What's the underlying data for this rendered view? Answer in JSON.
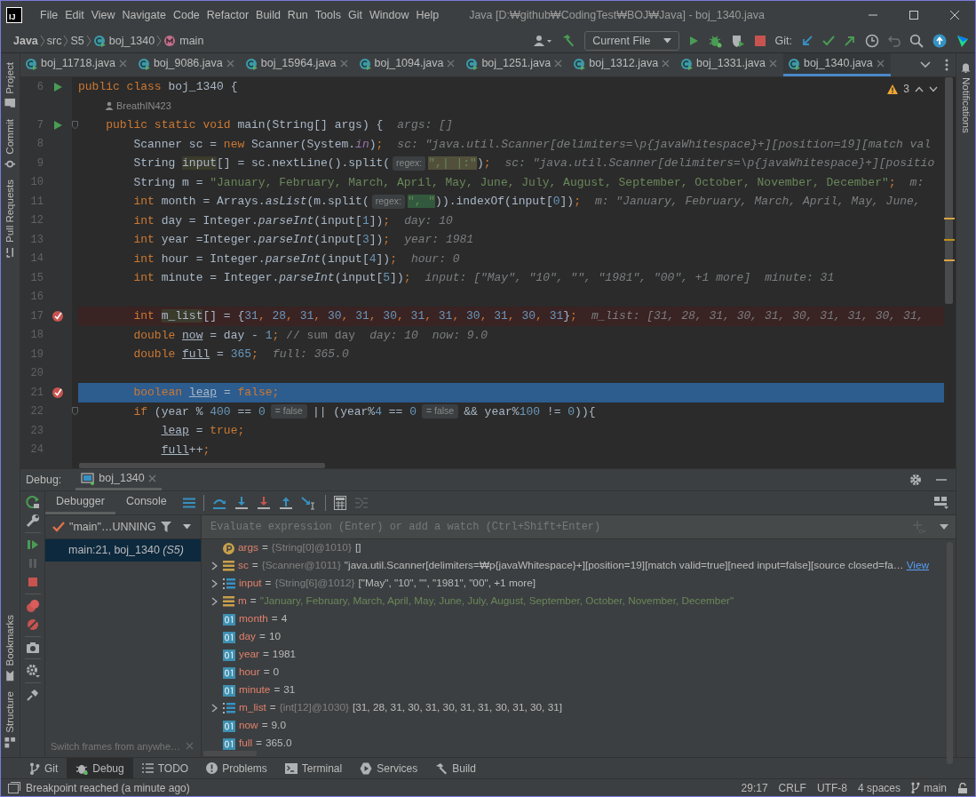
{
  "window": {
    "logo": "IJ",
    "title": "Java [D:₩github₩CodingTest₩BOJ₩Java] - boj_1340.java"
  },
  "menu": [
    "File",
    "Edit",
    "View",
    "Navigate",
    "Code",
    "Refactor",
    "Build",
    "Run",
    "Tools",
    "Git",
    "Window",
    "Help"
  ],
  "breadcrumbs": [
    {
      "kind": "root",
      "label": "Java"
    },
    {
      "kind": "plain",
      "label": "src"
    },
    {
      "kind": "plain",
      "label": "S5"
    },
    {
      "kind": "class",
      "label": "boj_1340"
    },
    {
      "kind": "method",
      "label": "main"
    }
  ],
  "toolbar": {
    "run_config": "Current File",
    "git_label": "Git:"
  },
  "left_tools": [
    {
      "kind": "project",
      "label": "Project"
    },
    {
      "kind": "commit",
      "label": "Commit"
    },
    {
      "kind": "pull",
      "label": "Pull Requests"
    }
  ],
  "left_tools_bottom": [
    {
      "kind": "bookmarks",
      "label": "Bookmarks"
    },
    {
      "kind": "structure",
      "label": "Structure"
    }
  ],
  "right_tools": [
    {
      "label": "Notifications"
    }
  ],
  "tabs": [
    {
      "label": "boj_11718.java",
      "selected": false
    },
    {
      "label": "boj_9086.java",
      "selected": false
    },
    {
      "label": "boj_15964.java",
      "selected": false
    },
    {
      "label": "boj_1094.java",
      "selected": false
    },
    {
      "label": "boj_1251.java",
      "selected": false
    },
    {
      "label": "boj_1312.java",
      "selected": false
    },
    {
      "label": "boj_1331.java",
      "selected": false
    },
    {
      "label": "boj_1340.java",
      "selected": true
    }
  ],
  "editor": {
    "warnings": "3",
    "lines": [
      {
        "kind": "code",
        "number": "6",
        "run": true,
        "breakpoint": false,
        "current": false,
        "fold": false,
        "parts": [
          {
            "kind": "code",
            "tokens": [
              {
                "kind": "kw",
                "text": "public class "
              },
              {
                "text": "boj_1340 {"
              }
            ]
          }
        ]
      },
      {
        "kind": "author",
        "text": "BreathIN423"
      },
      {
        "kind": "code",
        "number": "7",
        "run": true,
        "breakpoint": false,
        "current": false,
        "fold": true,
        "parts": [
          {
            "kind": "code",
            "tokens": [
              {
                "kind": "kw",
                "text": "    public static void "
              },
              {
                "text": "main(String[] args) {"
              }
            ]
          },
          {
            "kind": "hint",
            "text": "args: []"
          }
        ]
      },
      {
        "kind": "code",
        "number": "8",
        "run": false,
        "breakpoint": false,
        "current": false,
        "fold": false,
        "parts": [
          {
            "kind": "code",
            "tokens": [
              {
                "text": "        Scanner sc = "
              },
              {
                "kind": "kw",
                "text": "new "
              },
              {
                "text": "Scanner(System."
              },
              {
                "kind": "field",
                "text": "in"
              },
              {
                "text": ")"
              },
              {
                "kind": "kw",
                "text": ";"
              }
            ]
          },
          {
            "kind": "hint",
            "text": "sc: \"java.util.Scanner[delimiters=\\p{javaWhitespace}+][position=19][match val"
          }
        ]
      },
      {
        "kind": "code",
        "number": "9",
        "run": false,
        "breakpoint": false,
        "current": false,
        "fold": false,
        "parts": [
          {
            "kind": "code",
            "tokens": [
              {
                "text": "        String "
              },
              {
                "kind": "varhl",
                "text": "input"
              },
              {
                "text": "[] = sc.nextLine().split("
              }
            ]
          },
          {
            "kind": "param",
            "text": "regex:"
          },
          {
            "kind": "code",
            "tokens": [
              {
                "kind": "strhl",
                "text": "\",| |:\""
              },
              {
                "text": ")"
              },
              {
                "kind": "kw",
                "text": ";"
              }
            ]
          },
          {
            "kind": "hint",
            "text": "sc: \"java.util.Scanner[delimiters=\\p{javaWhitespace}+][positio"
          }
        ]
      },
      {
        "kind": "code",
        "number": "10",
        "run": false,
        "breakpoint": false,
        "current": false,
        "fold": false,
        "parts": [
          {
            "kind": "code",
            "tokens": [
              {
                "text": "        String m = "
              },
              {
                "kind": "str",
                "text": "\"January, February, March, April, May, June, July, August, September, October, November, December\""
              },
              {
                "kind": "kw",
                "text": ";"
              }
            ]
          },
          {
            "kind": "hint",
            "text": "m:"
          }
        ]
      },
      {
        "kind": "code",
        "number": "11",
        "run": false,
        "breakpoint": false,
        "current": false,
        "fold": false,
        "parts": [
          {
            "kind": "code",
            "tokens": [
              {
                "kind": "kw",
                "text": "        int "
              },
              {
                "text": "month = Arrays."
              },
              {
                "kind": "static",
                "text": "asList"
              },
              {
                "text": "(m.split("
              }
            ]
          },
          {
            "kind": "param",
            "text": "regex:"
          },
          {
            "kind": "code",
            "tokens": [
              {
                "kind": "strmatch",
                "text": "\", \""
              },
              {
                "text": ")).indexOf(input["
              },
              {
                "kind": "num",
                "text": "0"
              },
              {
                "text": "])"
              },
              {
                "kind": "kw",
                "text": ";"
              }
            ]
          },
          {
            "kind": "hint",
            "text": "m: \"January, February, March, April, May, June,"
          }
        ]
      },
      {
        "kind": "code",
        "number": "12",
        "run": false,
        "breakpoint": false,
        "current": false,
        "fold": false,
        "parts": [
          {
            "kind": "code",
            "tokens": [
              {
                "kind": "kw",
                "text": "        int "
              },
              {
                "text": "day = Integer."
              },
              {
                "kind": "static",
                "text": "parseInt"
              },
              {
                "text": "(input["
              },
              {
                "kind": "num",
                "text": "1"
              },
              {
                "text": "])"
              },
              {
                "kind": "kw",
                "text": ";"
              }
            ]
          },
          {
            "kind": "hint",
            "text": "day: 10"
          }
        ]
      },
      {
        "kind": "code",
        "number": "13",
        "run": false,
        "breakpoint": false,
        "current": false,
        "fold": false,
        "parts": [
          {
            "kind": "code",
            "tokens": [
              {
                "kind": "kw",
                "text": "        int "
              },
              {
                "text": "year =Integer."
              },
              {
                "kind": "static",
                "text": "parseInt"
              },
              {
                "text": "(input["
              },
              {
                "kind": "num",
                "text": "3"
              },
              {
                "text": "])"
              },
              {
                "kind": "kw",
                "text": ";"
              }
            ]
          },
          {
            "kind": "hint",
            "text": "year: 1981"
          }
        ]
      },
      {
        "kind": "code",
        "number": "14",
        "run": false,
        "breakpoint": false,
        "current": false,
        "fold": false,
        "parts": [
          {
            "kind": "code",
            "tokens": [
              {
                "kind": "kw",
                "text": "        int "
              },
              {
                "text": "hour = Integer."
              },
              {
                "kind": "static",
                "text": "parseInt"
              },
              {
                "text": "(input["
              },
              {
                "kind": "num",
                "text": "4"
              },
              {
                "text": "])"
              },
              {
                "kind": "kw",
                "text": ";"
              }
            ]
          },
          {
            "kind": "hint",
            "text": "hour: 0"
          }
        ]
      },
      {
        "kind": "code",
        "number": "15",
        "run": false,
        "breakpoint": false,
        "current": false,
        "fold": false,
        "parts": [
          {
            "kind": "code",
            "tokens": [
              {
                "kind": "kw",
                "text": "        int "
              },
              {
                "text": "minute = Integer."
              },
              {
                "kind": "static",
                "text": "parseInt"
              },
              {
                "text": "(input["
              },
              {
                "kind": "num",
                "text": "5"
              },
              {
                "text": "])"
              },
              {
                "kind": "kw",
                "text": ";"
              }
            ]
          },
          {
            "kind": "hint",
            "text": "input: [\"May\", \"10\", \"\", \"1981\", \"00\", +1 more]"
          },
          {
            "kind": "hint",
            "text": "minute: 31"
          }
        ]
      },
      {
        "kind": "code",
        "number": "16",
        "run": false,
        "breakpoint": false,
        "current": false,
        "fold": false
      },
      {
        "kind": "code",
        "number": "17",
        "run": false,
        "breakpoint": true,
        "current": false,
        "fold": false,
        "parts": [
          {
            "kind": "code",
            "tokens": [
              {
                "kind": "kw",
                "text": "        int "
              },
              {
                "kind": "varhl",
                "text": "m_list"
              },
              {
                "text": "[] = {"
              },
              {
                "kind": "num",
                "text": "31"
              },
              {
                "kind": "kw",
                "text": ", "
              },
              {
                "kind": "num",
                "text": "28"
              },
              {
                "kind": "kw",
                "text": ", "
              },
              {
                "kind": "num",
                "text": "31"
              },
              {
                "kind": "kw",
                "text": ", "
              },
              {
                "kind": "num",
                "text": "30"
              },
              {
                "kind": "kw",
                "text": ", "
              },
              {
                "kind": "num",
                "text": "31"
              },
              {
                "kind": "kw",
                "text": ", "
              },
              {
                "kind": "num",
                "text": "30"
              },
              {
                "kind": "kw",
                "text": ", "
              },
              {
                "kind": "num",
                "text": "31"
              },
              {
                "kind": "kw",
                "text": ", "
              },
              {
                "kind": "num",
                "text": "31"
              },
              {
                "kind": "kw",
                "text": ", "
              },
              {
                "kind": "num",
                "text": "30"
              },
              {
                "kind": "kw",
                "text": ", "
              },
              {
                "kind": "num",
                "text": "31"
              },
              {
                "kind": "kw",
                "text": ", "
              },
              {
                "kind": "num",
                "text": "30"
              },
              {
                "kind": "kw",
                "text": ", "
              },
              {
                "kind": "num",
                "text": "31"
              },
              {
                "text": "}"
              },
              {
                "kind": "kw",
                "text": ";"
              }
            ]
          },
          {
            "kind": "hint",
            "text": "m_list: [31, 28, 31, 30, 31, 30, 31, 31, 30, 31,"
          }
        ]
      },
      {
        "kind": "code",
        "number": "18",
        "run": false,
        "breakpoint": false,
        "current": false,
        "fold": false,
        "parts": [
          {
            "kind": "code",
            "tokens": [
              {
                "kind": "kw",
                "text": "        double "
              },
              {
                "kind": "under",
                "text": "now"
              },
              {
                "text": " = day - "
              },
              {
                "kind": "num",
                "text": "1"
              },
              {
                "kind": "kw",
                "text": ";"
              },
              {
                "kind": "comment",
                "text": " // sum day"
              }
            ]
          },
          {
            "kind": "hint",
            "text": "day: 10"
          },
          {
            "kind": "hint",
            "text": "now: 9.0"
          }
        ]
      },
      {
        "kind": "code",
        "number": "19",
        "run": false,
        "breakpoint": false,
        "current": false,
        "fold": false,
        "parts": [
          {
            "kind": "code",
            "tokens": [
              {
                "kind": "kw",
                "text": "        double "
              },
              {
                "kind": "under",
                "text": "full"
              },
              {
                "text": " = "
              },
              {
                "kind": "num",
                "text": "365"
              },
              {
                "kind": "kw",
                "text": ";"
              }
            ]
          },
          {
            "kind": "hint",
            "text": "full: 365.0"
          }
        ]
      },
      {
        "kind": "code",
        "number": "20",
        "run": false,
        "breakpoint": false,
        "current": false,
        "fold": false
      },
      {
        "kind": "code",
        "number": "21",
        "run": false,
        "breakpoint": true,
        "current": true,
        "fold": false,
        "parts": [
          {
            "kind": "code",
            "tokens": [
              {
                "kind": "kw",
                "text": "        boolean "
              },
              {
                "kind": "under",
                "text": "leap"
              },
              {
                "text": " = "
              },
              {
                "kind": "kw",
                "text": "false;"
              }
            ]
          }
        ]
      },
      {
        "kind": "code",
        "number": "22",
        "run": false,
        "breakpoint": false,
        "current": false,
        "fold": true,
        "parts": [
          {
            "kind": "code",
            "tokens": [
              {
                "kind": "kw",
                "text": "        if "
              },
              {
                "text": "(year % "
              },
              {
                "kind": "num",
                "text": "400"
              },
              {
                "text": " == "
              },
              {
                "kind": "num",
                "text": "0"
              }
            ]
          },
          {
            "kind": "value",
            "text": "= false"
          },
          {
            "kind": "code",
            "tokens": [
              {
                "text": "|| (year%"
              },
              {
                "kind": "num",
                "text": "4"
              },
              {
                "text": " == "
              },
              {
                "kind": "num",
                "text": "0"
              }
            ]
          },
          {
            "kind": "value",
            "text": "= false"
          },
          {
            "kind": "code",
            "tokens": [
              {
                "text": "&& year%"
              },
              {
                "kind": "num",
                "text": "100"
              },
              {
                "text": " != "
              },
              {
                "kind": "num",
                "text": "0"
              },
              {
                "text": ")){"
              }
            ]
          }
        ]
      },
      {
        "kind": "code",
        "number": "23",
        "run": false,
        "breakpoint": false,
        "current": false,
        "fold": false,
        "parts": [
          {
            "kind": "code",
            "tokens": [
              {
                "kind": "under",
                "text": "            leap"
              },
              {
                "text": " = "
              },
              {
                "kind": "kw",
                "text": "true;"
              }
            ]
          }
        ]
      },
      {
        "kind": "code",
        "number": "24",
        "run": false,
        "breakpoint": false,
        "current": false,
        "fold": false,
        "parts": [
          {
            "kind": "code",
            "tokens": [
              {
                "kind": "under",
                "text": "            full"
              },
              {
                "text": "++"
              },
              {
                "kind": "kw",
                "text": ";"
              }
            ]
          }
        ]
      }
    ]
  },
  "debug": {
    "title": "Debug:",
    "session": "boj_1340",
    "tabs": [
      {
        "label": "Debugger",
        "selected": true
      },
      {
        "label": "Console",
        "selected": false
      }
    ],
    "thread": "\"main\"…UNNING",
    "frames": [
      {
        "label": "main:21, boj_1340 *(S5)*",
        "selected": true
      }
    ],
    "frames_hint": "Switch frames from anywhe…",
    "evaluate_placeholder": "Evaluate expression (Enter) or add a watch (Ctrl+Shift+Enter)",
    "variables": [
      {
        "kind": "param",
        "expandable": false,
        "name": "args",
        "sign": "=",
        "type": "{String[0]@1010}",
        "value": "[]",
        "quoted": false
      },
      {
        "kind": "object",
        "expandable": true,
        "name": "sc",
        "sign": "=",
        "type": "{Scanner@1011}",
        "value": "\"java.util.Scanner[delimiters=₩p{javaWhitespace}+][position=19][match valid=true][need input=false][source closed=fa…",
        "quoted": false,
        "link": "View"
      },
      {
        "kind": "array",
        "expandable": true,
        "name": "input",
        "sign": "=",
        "type": "{String[6]@1012}",
        "value": "[\"May\", \"10\", \"\", \"1981\", \"00\", +1 more]",
        "quoted": false
      },
      {
        "kind": "object",
        "expandable": true,
        "name": "m",
        "sign": "=",
        "value": "\"January, February, March, April, May, June, July, August, September, October, November, December\"",
        "quoted": true
      },
      {
        "kind": "primitive",
        "expandable": false,
        "name": "month",
        "sign": "=",
        "value": "4",
        "quoted": false
      },
      {
        "kind": "primitive",
        "expandable": false,
        "name": "day",
        "sign": "=",
        "value": "10",
        "quoted": false
      },
      {
        "kind": "primitive",
        "expandable": false,
        "name": "year",
        "sign": "=",
        "value": "1981",
        "quoted": false
      },
      {
        "kind": "primitive",
        "expandable": false,
        "name": "hour",
        "sign": "=",
        "value": "0",
        "quoted": false
      },
      {
        "kind": "primitive",
        "expandable": false,
        "name": "minute",
        "sign": "=",
        "value": "31",
        "quoted": false
      },
      {
        "kind": "array",
        "expandable": true,
        "name": "m_list",
        "sign": "=",
        "type": "{int[12]@1030}",
        "value": "[31, 28, 31, 30, 31, 30, 31, 31, 30, 31, 30, 31]",
        "quoted": false
      },
      {
        "kind": "primitive",
        "expandable": false,
        "name": "now",
        "sign": "=",
        "value": "9.0",
        "quoted": false
      },
      {
        "kind": "primitive",
        "expandable": false,
        "name": "full",
        "sign": "=",
        "value": "365.0",
        "quoted": false
      }
    ]
  },
  "bottom_tools": [
    {
      "kind": "git",
      "label": "Git",
      "selected": false
    },
    {
      "kind": "debug",
      "label": "Debug",
      "selected": true
    },
    {
      "kind": "todo",
      "label": "TODO",
      "selected": false
    },
    {
      "kind": "problems",
      "label": "Problems",
      "selected": false
    },
    {
      "kind": "terminal",
      "label": "Terminal",
      "selected": false
    },
    {
      "kind": "services",
      "label": "Services",
      "selected": false
    },
    {
      "kind": "build",
      "label": "Build",
      "selected": false
    }
  ],
  "status_bar": {
    "message": "Breakpoint reached (a minute ago)",
    "items": [
      "29:17",
      "CRLF",
      "UTF-8",
      "4 spaces"
    ],
    "branch": "main"
  }
}
